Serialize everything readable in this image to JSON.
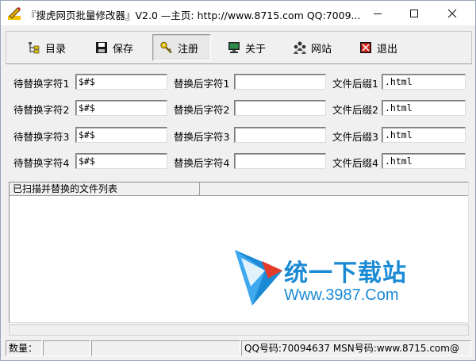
{
  "window": {
    "title": "『搜虎网页批量修改器』V2.0 —主页: http://www.8715.com QQ:7009..."
  },
  "toolbar": {
    "items": [
      {
        "label": "目录",
        "icon": "folder-tree-icon"
      },
      {
        "label": "保存",
        "icon": "floppy-disk-icon"
      },
      {
        "label": "注册",
        "icon": "key-icon"
      },
      {
        "label": "关于",
        "icon": "monitor-icon"
      },
      {
        "label": "网站",
        "icon": "people-icon"
      },
      {
        "label": "退出",
        "icon": "exit-icon"
      }
    ]
  },
  "form": {
    "rows": [
      {
        "find_label": "待替换字符1",
        "find_value": "$#$",
        "replace_label": "替换后字符1",
        "replace_value": "",
        "ext_label": "文件后缀1",
        "ext_value": ".html"
      },
      {
        "find_label": "待替换字符2",
        "find_value": "$#$",
        "replace_label": "替换后字符2",
        "replace_value": "",
        "ext_label": "文件后缀2",
        "ext_value": ".html"
      },
      {
        "find_label": "待替换字符3",
        "find_value": "$#$",
        "replace_label": "替换后字符3",
        "replace_value": "",
        "ext_label": "文件后缀3",
        "ext_value": ".html"
      },
      {
        "find_label": "待替换字符4",
        "find_value": "$#$",
        "replace_label": "替换后字符4",
        "replace_value": "",
        "ext_label": "文件后缀4",
        "ext_value": ".html"
      }
    ]
  },
  "list": {
    "column_header": "已扫描并替换的文件列表"
  },
  "watermark": {
    "line1": "统一下载站",
    "line2": "Www.3987.Com"
  },
  "statusbar": {
    "count_label": "数量：",
    "count_value": "",
    "middle": "",
    "contact": "QQ号码:70094637 MSN号码:www.8715.com@"
  },
  "colors": {
    "watermark_blue": "#1a8ad4",
    "watermark_red": "#e23b2a"
  }
}
